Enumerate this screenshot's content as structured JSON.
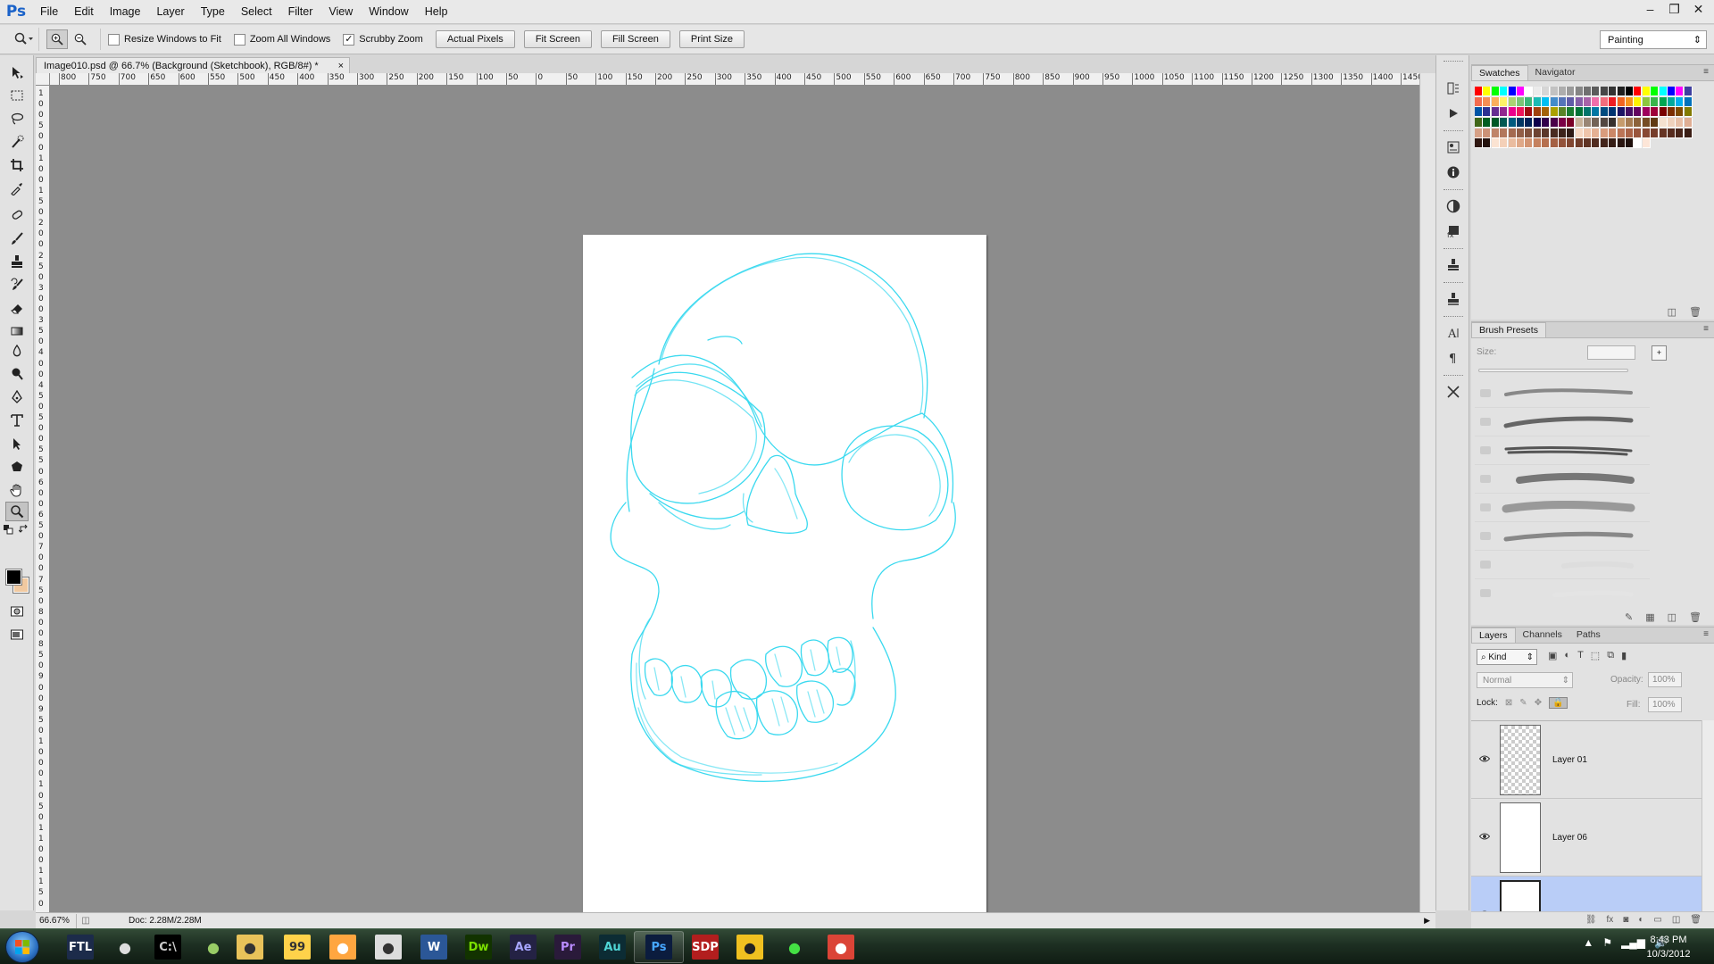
{
  "app": {
    "logo": "Ps",
    "title_tab": "Image010.psd @ 66.7% (Background (Sketchbook), RGB/8#) *",
    "tab_close": "×"
  },
  "menu": [
    "File",
    "Edit",
    "Image",
    "Layer",
    "Type",
    "Select",
    "Filter",
    "View",
    "Window",
    "Help"
  ],
  "window_controls": {
    "minimize": "–",
    "restore": "❐",
    "close": "✕"
  },
  "options": {
    "tool_icon": "zoom-icon",
    "resize_windows_label": "Resize Windows to Fit",
    "resize_windows_checked": false,
    "zoom_all_label": "Zoom All Windows",
    "zoom_all_checked": false,
    "scrubby_zoom_label": "Scrubby Zoom",
    "scrubby_zoom_checked": true,
    "actual_pixels": "Actual Pixels",
    "fit_screen": "Fit Screen",
    "fill_screen": "Fill Screen",
    "print_size": "Print Size",
    "workspace": "Painting"
  },
  "ruler_h_labels": [
    "800",
    "750",
    "700",
    "650",
    "600",
    "550",
    "500",
    "450",
    "400",
    "350",
    "300",
    "250",
    "200",
    "150",
    "100",
    "50",
    "0",
    "50",
    "100",
    "150",
    "200",
    "250",
    "300",
    "350",
    "400",
    "450",
    "500",
    "550",
    "600",
    "650",
    "700",
    "750",
    "800",
    "850",
    "900",
    "950",
    "1000",
    "1050",
    "1100",
    "1150",
    "1200",
    "1250",
    "1300",
    "1350",
    "1400",
    "1450"
  ],
  "ruler_v_labels": [
    "1",
    "0",
    "0",
    "5",
    "0",
    "0",
    "1",
    "0",
    "0",
    "1",
    "5",
    "0",
    "2",
    "0",
    "0",
    "2",
    "5",
    "0",
    "3",
    "0",
    "0",
    "3",
    "5",
    "0",
    "4",
    "0",
    "0",
    "4",
    "5",
    "0",
    "5",
    "0",
    "0",
    "5",
    "5",
    "0",
    "6",
    "0",
    "0",
    "6",
    "5",
    "0",
    "7",
    "0",
    "0",
    "7",
    "5",
    "0",
    "8",
    "0",
    "0",
    "8",
    "5",
    "0",
    "9",
    "0",
    "0",
    "9",
    "5",
    "0",
    "1",
    "0",
    "0",
    "0",
    "1",
    "0",
    "5",
    "0",
    "1",
    "1",
    "0",
    "0",
    "1",
    "1",
    "5",
    "0"
  ],
  "status": {
    "zoom": "66.67%",
    "doc": "Doc: 2.28M/2.28M",
    "arrow": "▶"
  },
  "swatches_panel": {
    "tabs": [
      "Swatches",
      "Navigator"
    ],
    "menu": "≡"
  },
  "swatch_colors": [
    "#ff0000",
    "#ffff00",
    "#00ff00",
    "#00ffff",
    "#0000ff",
    "#ff00ff",
    "#ffffff",
    "#ebebeb",
    "#d6d6d6",
    "#c2c2c2",
    "#adadad",
    "#999999",
    "#858585",
    "#707070",
    "#5c5c5c",
    "#474747",
    "#333333",
    "#1f1f1f",
    "#000000",
    "#ff0000",
    "#ffff00",
    "#00ff00",
    "#00ffff",
    "#0000ff",
    "#ff00ff",
    "#3f3f9f",
    "#f26c4f",
    "#f68e55",
    "#fbaf5c",
    "#fff467",
    "#acd372",
    "#7cc576",
    "#3bb878",
    "#1abbb4",
    "#00bff3",
    "#438ccb",
    "#5574b9",
    "#605ca8",
    "#855fa8",
    "#a763a8",
    "#f06eaa",
    "#f26d7d",
    "#ed1c24",
    "#f26522",
    "#f7941d",
    "#fff200",
    "#8dc73f",
    "#39b54a",
    "#00a651",
    "#00a99d",
    "#00aeef",
    "#0072bc",
    "#0054a6",
    "#2e3192",
    "#662d91",
    "#92278f",
    "#ec008c",
    "#ed145b",
    "#9e0b0f",
    "#a0410d",
    "#a36209",
    "#aba000",
    "#598527",
    "#1a7b30",
    "#007236",
    "#00746b",
    "#0076a3",
    "#004b80",
    "#003471",
    "#1b1464",
    "#440e62",
    "#630460",
    "#9e005d",
    "#9e0039",
    "#790000",
    "#7b2e00",
    "#7d4900",
    "#827b00",
    "#406618",
    "#005e20",
    "#005826",
    "#005952",
    "#005b7f",
    "#003663",
    "#002157",
    "#0d004c",
    "#32004b",
    "#4b0049",
    "#7b0046",
    "#7a0026",
    "#c7b299",
    "#998675",
    "#736357",
    "#534741",
    "#37302d",
    "#c69c6d",
    "#a67c52",
    "#8c6239",
    "#754c24",
    "#603913",
    "#f5e1d0",
    "#f0d2bd",
    "#e8c0a8",
    "#dfae94",
    "#d6a086",
    "#cc9277",
    "#bf8469",
    "#b2775c",
    "#a46a50",
    "#925e47",
    "#80513d",
    "#6d4333",
    "#5b372a",
    "#4a2c22",
    "#3c231b",
    "#2f1b15",
    "#f7d9c4",
    "#efc5ab",
    "#e5b194",
    "#d99c7d",
    "#cb8868",
    "#bc7557",
    "#ab6448",
    "#99553c",
    "#874833",
    "#763d2b",
    "#663424",
    "#572c1f",
    "#48251a",
    "#3b1e15",
    "#2f1711",
    "#24120d",
    "#fbe3d2",
    "#f4d0b8",
    "#eabc9f",
    "#dfa888",
    "#d39472",
    "#c5815f",
    "#b6704f",
    "#a56043",
    "#93533a",
    "#814731",
    "#703d2a",
    "#603424",
    "#512c1f",
    "#43241a",
    "#361d15",
    "#2a1611",
    "#1f100c",
    "#ffffff",
    "#fde6d8"
  ],
  "brush_presets": {
    "title": "Brush Presets",
    "size_label": "Size:",
    "new_label": "+",
    "menu": "≡"
  },
  "dock_icons": [
    "history-icon",
    "actions-icon",
    "properties-icon",
    "info-icon",
    "adjustments-icon",
    "styles-icon",
    "clone-source-icon",
    "tool-presets-icon",
    "character-icon",
    "paragraph-icon",
    "brush-icon"
  ],
  "layers_panel": {
    "tabs": [
      "Layers",
      "Channels",
      "Paths"
    ],
    "menu": "≡",
    "kind": "Kind",
    "blend_mode": "Normal",
    "opacity_label": "Opacity:",
    "opacity": "100%",
    "lock_label": "Lock:",
    "fill_label": "Fill:",
    "fill": "100%",
    "layers": [
      {
        "name": "Layer 01",
        "visible": true,
        "transparent": true,
        "selected": false
      },
      {
        "name": "Layer 06",
        "visible": true,
        "transparent": false,
        "selected": false
      },
      {
        "name": "",
        "visible": true,
        "transparent": false,
        "selected": true
      }
    ]
  },
  "taskbar": {
    "apps": [
      {
        "name": "ftl-app",
        "label": "FTL",
        "open": false
      },
      {
        "name": "pen-app",
        "label": "",
        "open": false
      },
      {
        "name": "cmd-app",
        "label": "C:\\",
        "open": false
      },
      {
        "name": "network-app",
        "label": "",
        "open": false
      },
      {
        "name": "explorer-app",
        "label": "",
        "open": false
      },
      {
        "name": "notepad-app",
        "label": "99",
        "open": false
      },
      {
        "name": "media-player-app",
        "label": "",
        "open": false
      },
      {
        "name": "clock-app",
        "label": "",
        "open": false
      },
      {
        "name": "word-app",
        "label": "W",
        "open": false
      },
      {
        "name": "dreamweaver-app",
        "label": "Dw",
        "open": false
      },
      {
        "name": "after-effects-app",
        "label": "Ae",
        "open": false
      },
      {
        "name": "premiere-app",
        "label": "Pr",
        "open": false
      },
      {
        "name": "audition-app",
        "label": "Au",
        "open": false
      },
      {
        "name": "photoshop-app",
        "label": "Ps",
        "open": true
      },
      {
        "name": "sdp-app",
        "label": "SDP",
        "open": false
      },
      {
        "name": "winamp-app",
        "label": "",
        "open": false
      },
      {
        "name": "razer-app",
        "label": "",
        "open": false
      },
      {
        "name": "chrome-app",
        "label": "",
        "open": false
      }
    ],
    "time": "8:43 PM",
    "date": "10/3/2012"
  }
}
